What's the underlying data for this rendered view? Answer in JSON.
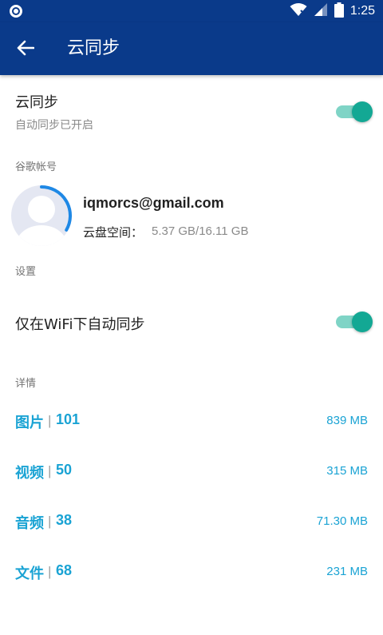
{
  "status_bar": {
    "time": "1:25",
    "icons": [
      "notification-ring-icon",
      "wifi-icon",
      "signal-icon",
      "battery-icon"
    ]
  },
  "toolbar": {
    "title": "云同步",
    "back_icon": "arrow-left-icon"
  },
  "cloud_sync": {
    "title": "云同步",
    "subtitle": "自动同步已开启",
    "enabled": true
  },
  "account": {
    "header": "谷歌帐号",
    "email": "iqmorcs@gmail.com",
    "storage_label": "云盘空间：",
    "storage_value": "5.37 GB/16.11 GB",
    "storage_used_fraction": 0.333
  },
  "settings": {
    "header": "设置",
    "wifi_only_label": "仅在WiFi下自动同步",
    "wifi_only_enabled": true
  },
  "details": {
    "header": "详情",
    "items": [
      {
        "name": "图片",
        "sep": "|",
        "count": "101",
        "size": "839 MB"
      },
      {
        "name": "视频",
        "sep": "|",
        "count": "50",
        "size": "315 MB"
      },
      {
        "name": "音频",
        "sep": "|",
        "count": "38",
        "size": "71.30 MB"
      },
      {
        "name": "文件",
        "sep": "|",
        "count": "68",
        "size": "231 MB"
      }
    ]
  },
  "colors": {
    "primary": "#0a3a8a",
    "accent": "#13a894",
    "link": "#1aa3d4",
    "progress": "#1e88e5"
  }
}
